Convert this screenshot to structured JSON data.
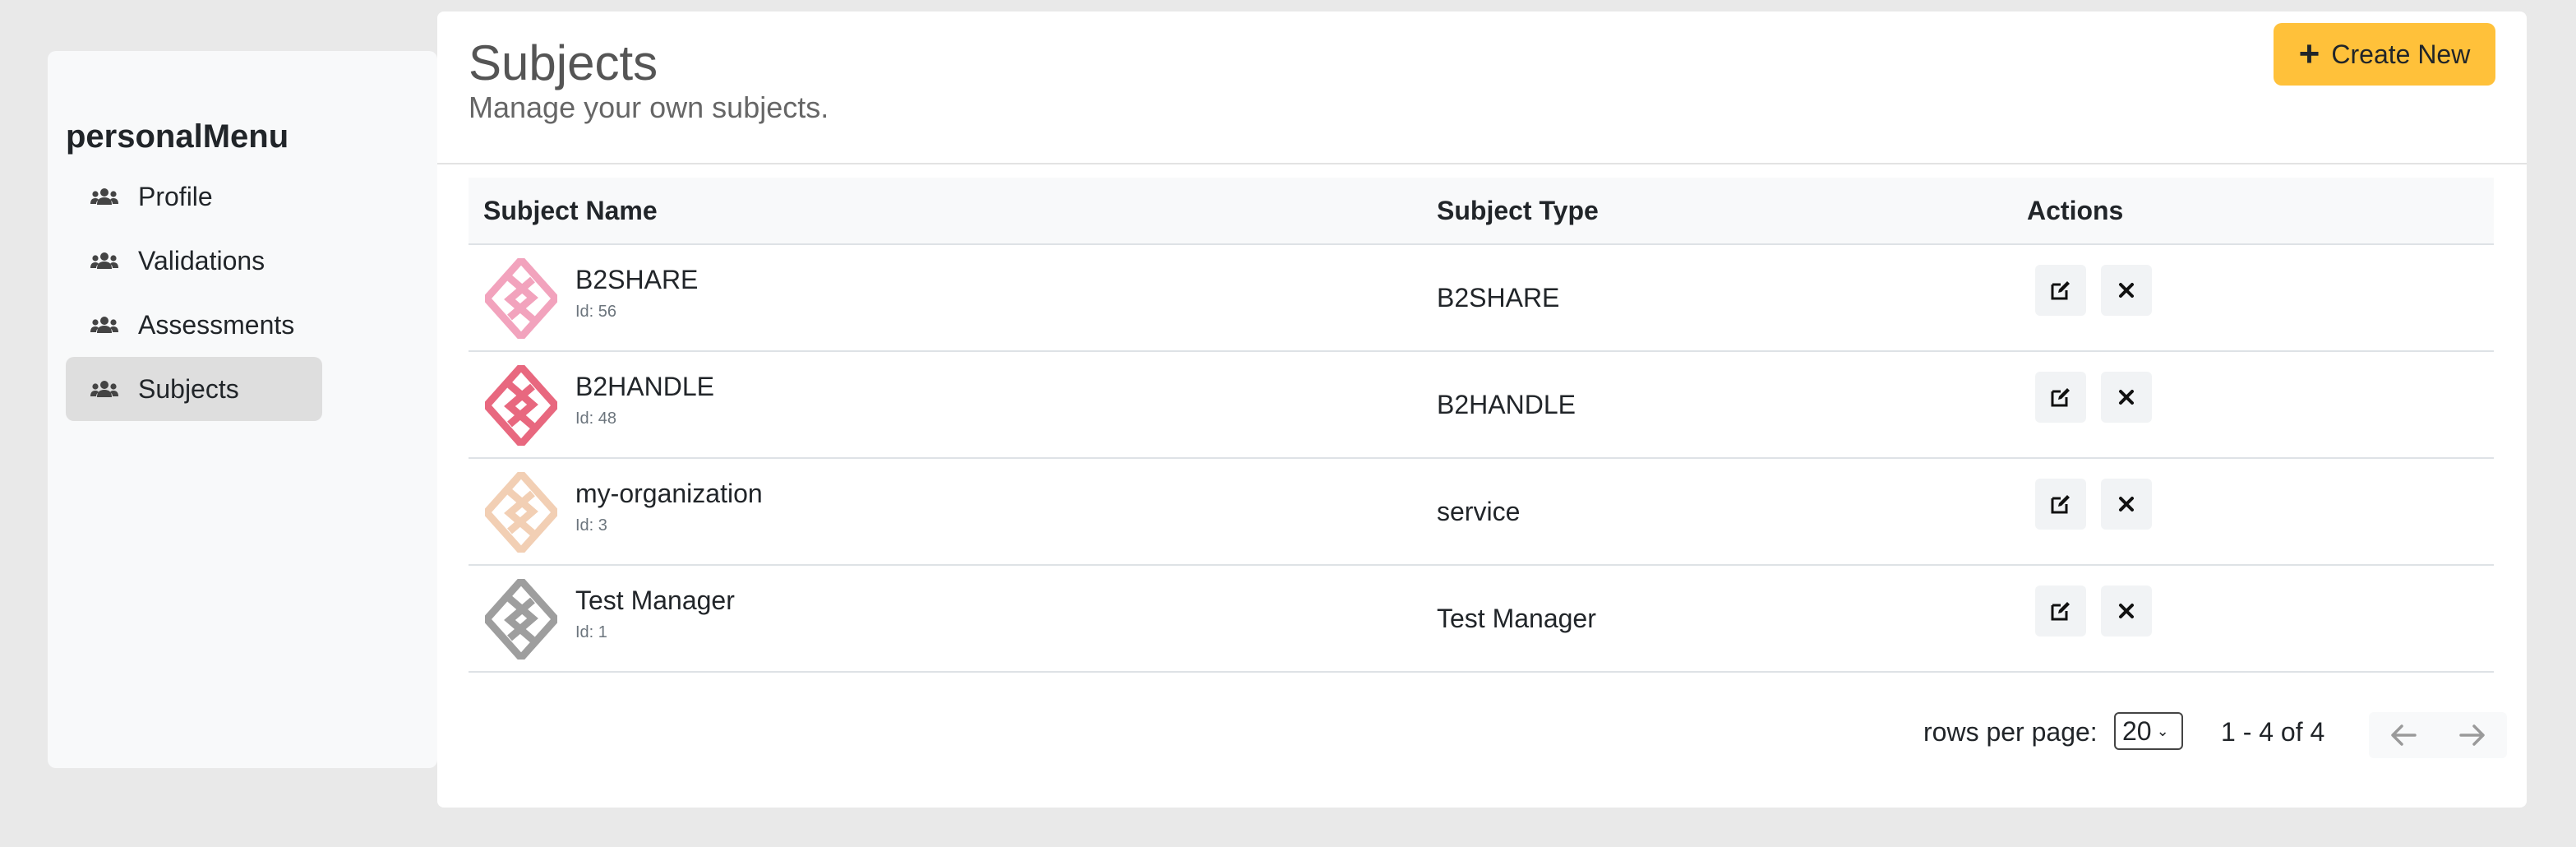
{
  "sidebar": {
    "title": "personalMenu",
    "items": [
      {
        "label": "Profile",
        "icon": "users-icon",
        "active": false
      },
      {
        "label": "Validations",
        "icon": "users-icon",
        "active": false
      },
      {
        "label": "Assessments",
        "icon": "users-icon",
        "active": false
      },
      {
        "label": "Subjects",
        "icon": "users-icon",
        "active": true
      }
    ]
  },
  "header": {
    "title": "Subjects",
    "subtitle": "Manage your own subjects.",
    "create_label": "Create New",
    "create_icon": "plus-icon",
    "accent_color": "#ffc13a"
  },
  "table": {
    "columns": [
      "Subject Name",
      "Subject Type",
      "Actions"
    ],
    "rows": [
      {
        "name": "B2SHARE",
        "id_label": "Id: 56",
        "type": "B2SHARE",
        "logo_color": "#f2a3bd"
      },
      {
        "name": "B2HANDLE",
        "id_label": "Id: 48",
        "type": "B2HANDLE",
        "logo_color": "#e8687f"
      },
      {
        "name": "my-organization",
        "id_label": "Id: 3",
        "type": "service",
        "logo_color": "#f2cfb4"
      },
      {
        "name": "Test Manager",
        "id_label": "Id: 1",
        "type": "Test Manager",
        "logo_color": "#9e9e9e"
      }
    ],
    "action_icons": [
      "edit-icon",
      "close-icon"
    ]
  },
  "pagination": {
    "rows_label": "rows per page:",
    "rows_value": "20",
    "range": "1 - 4 of 4",
    "prev_icon": "arrow-left-icon",
    "next_icon": "arrow-right-icon"
  }
}
